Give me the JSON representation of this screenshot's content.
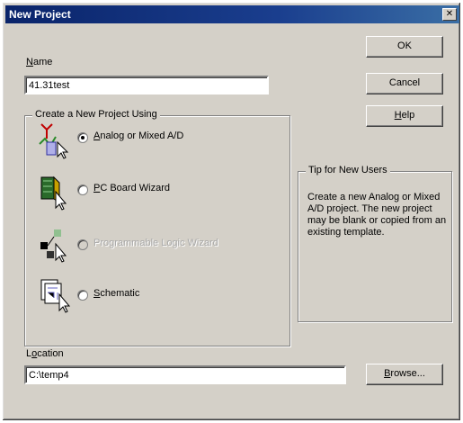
{
  "window": {
    "title": "New Project",
    "close_glyph": "✕"
  },
  "name_field": {
    "label": "Name",
    "value": "41.31test"
  },
  "create_group": {
    "title": "Create a New Project Using",
    "options": [
      {
        "label": "Analog or Mixed A/D",
        "checked": true,
        "enabled": true,
        "icon": "analog-schematic-icon"
      },
      {
        "label": "PC Board Wizard",
        "checked": false,
        "enabled": true,
        "icon": "pcb-wizard-icon"
      },
      {
        "label": "Programmable Logic Wizard",
        "checked": false,
        "enabled": false,
        "icon": "programmable-logic-icon"
      },
      {
        "label": "Schematic",
        "checked": false,
        "enabled": true,
        "icon": "schematic-icon"
      }
    ]
  },
  "tip": {
    "title": "Tip for New Users",
    "text": "Create a new Analog or Mixed A/D project. The new project may be blank or copied from an existing template."
  },
  "buttons": {
    "ok": "OK",
    "cancel": "Cancel",
    "help": "Help",
    "browse": "Browse..."
  },
  "location_field": {
    "label": "Location",
    "value": "C:\\temp4"
  },
  "colors": {
    "face": "#d4d0c8",
    "title_start": "#0a246a",
    "title_end": "#3a6ea5"
  }
}
